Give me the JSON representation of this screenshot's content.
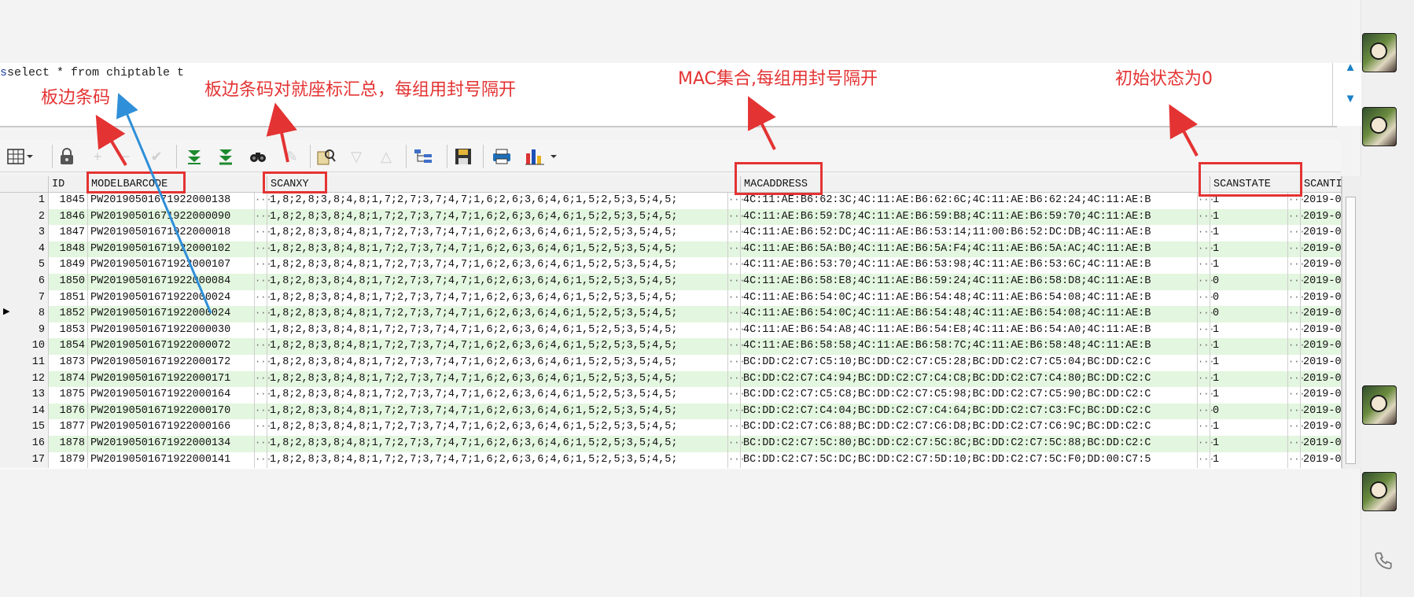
{
  "sql": {
    "text": "select * from chiptable t"
  },
  "annotations": {
    "note1": "板边条码",
    "note2": "板边条码对就座标汇总，每组用封号隔开",
    "note3": "MAC集合,每组用封号隔开",
    "note4": "初始状态为0"
  },
  "columns": [
    "ID",
    "MODELBARCODE",
    "SCANXY",
    "MACADDRESS",
    "SCANSTATE",
    "SCANTI"
  ],
  "rows": [
    {
      "n": "1",
      "id": "1845",
      "bc": "PW20190501671922000138",
      "xy": "1,8;2,8;3,8;4,8;1,7;2,7;3,7;4,7;1,6;2,6;3,6;4,6;1,5;2,5;3,5;4,5;",
      "mac": "4C:11:AE:B6:62:3C;4C:11:AE:B6:62:6C;4C:11:AE:B6:62:24;4C:11:AE:B",
      "st": "1",
      "dt": "2019-0"
    },
    {
      "n": "2",
      "id": "1846",
      "bc": "PW20190501671922000090",
      "xy": "1,8;2,8;3,8;4,8;1,7;2,7;3,7;4,7;1,6;2,6;3,6;4,6;1,5;2,5;3,5;4,5;",
      "mac": "4C:11:AE:B6:59:78;4C:11:AE:B6:59:B8;4C:11:AE:B6:59:70;4C:11:AE:B",
      "st": "1",
      "dt": "2019-0"
    },
    {
      "n": "3",
      "id": "1847",
      "bc": "PW20190501671922000018",
      "xy": "1,8;2,8;3,8;4,8;1,7;2,7;3,7;4,7;1,6;2,6;3,6;4,6;1,5;2,5;3,5;4,5;",
      "mac": "4C:11:AE:B6:52:DC;4C:11:AE:B6:53:14;11:00:B6:52:DC:DB;4C:11:AE:B",
      "st": "1",
      "dt": "2019-0"
    },
    {
      "n": "4",
      "id": "1848",
      "bc": "PW20190501671922000102",
      "xy": "1,8;2,8;3,8;4,8;1,7;2,7;3,7;4,7;1,6;2,6;3,6;4,6;1,5;2,5;3,5;4,5;",
      "mac": "4C:11:AE:B6:5A:B0;4C:11:AE:B6:5A:F4;4C:11:AE:B6:5A:AC;4C:11:AE:B",
      "st": "1",
      "dt": "2019-0"
    },
    {
      "n": "5",
      "id": "1849",
      "bc": "PW20190501671922000107",
      "xy": "1,8;2,8;3,8;4,8;1,7;2,7;3,7;4,7;1,6;2,6;3,6;4,6;1,5;2,5;3,5;4,5;",
      "mac": "4C:11:AE:B6:53:70;4C:11:AE:B6:53:98;4C:11:AE:B6:53:6C;4C:11:AE:B",
      "st": "1",
      "dt": "2019-0"
    },
    {
      "n": "6",
      "id": "1850",
      "bc": "PW20190501671922000084",
      "xy": "1,8;2,8;3,8;4,8;1,7;2,7;3,7;4,7;1,6;2,6;3,6;4,6;1,5;2,5;3,5;4,5;",
      "mac": "4C:11:AE:B6:58:E8;4C:11:AE:B6:59:24;4C:11:AE:B6:58:D8;4C:11:AE:B",
      "st": "0",
      "dt": "2019-0"
    },
    {
      "n": "7",
      "id": "1851",
      "bc": "PW20190501671922000024",
      "xy": "1,8;2,8;3,8;4,8;1,7;2,7;3,7;4,7;1,6;2,6;3,6;4,6;1,5;2,5;3,5;4,5;",
      "mac": "4C:11:AE:B6:54:0C;4C:11:AE:B6:54:48;4C:11:AE:B6:54:08;4C:11:AE:B",
      "st": "0",
      "dt": "2019-0"
    },
    {
      "n": "8",
      "id": "1852",
      "bc": "PW20190501671922000024",
      "xy": "1,8;2,8;3,8;4,8;1,7;2,7;3,7;4,7;1,6;2,6;3,6;4,6;1,5;2,5;3,5;4,5;",
      "mac": "4C:11:AE:B6:54:0C;4C:11:AE:B6:54:48;4C:11:AE:B6:54:08;4C:11:AE:B",
      "st": "0",
      "dt": "2019-0"
    },
    {
      "n": "9",
      "id": "1853",
      "bc": "PW20190501671922000030",
      "xy": "1,8;2,8;3,8;4,8;1,7;2,7;3,7;4,7;1,6;2,6;3,6;4,6;1,5;2,5;3,5;4,5;",
      "mac": "4C:11:AE:B6:54:A8;4C:11:AE:B6:54:E8;4C:11:AE:B6:54:A0;4C:11:AE:B",
      "st": "1",
      "dt": "2019-0"
    },
    {
      "n": "10",
      "id": "1854",
      "bc": "PW20190501671922000072",
      "xy": "1,8;2,8;3,8;4,8;1,7;2,7;3,7;4,7;1,6;2,6;3,6;4,6;1,5;2,5;3,5;4,5;",
      "mac": "4C:11:AE:B6:58:58;4C:11:AE:B6:58:7C;4C:11:AE:B6:58:48;4C:11:AE:B",
      "st": "1",
      "dt": "2019-0"
    },
    {
      "n": "11",
      "id": "1873",
      "bc": "PW20190501671922000172",
      "xy": "1,8;2,8;3,8;4,8;1,7;2,7;3,7;4,7;1,6;2,6;3,6;4,6;1,5;2,5;3,5;4,5;",
      "mac": "BC:DD:C2:C7:C5:10;BC:DD:C2:C7:C5:28;BC:DD:C2:C7:C5:04;BC:DD:C2:C",
      "st": "1",
      "dt": "2019-0"
    },
    {
      "n": "12",
      "id": "1874",
      "bc": "PW20190501671922000171",
      "xy": "1,8;2,8;3,8;4,8;1,7;2,7;3,7;4,7;1,6;2,6;3,6;4,6;1,5;2,5;3,5;4,5;",
      "mac": "BC:DD:C2:C7:C4:94;BC:DD:C2:C7:C4:C8;BC:DD:C2:C7:C4:80;BC:DD:C2:C",
      "st": "1",
      "dt": "2019-0"
    },
    {
      "n": "13",
      "id": "1875",
      "bc": "PW20190501671922000164",
      "xy": "1,8;2,8;3,8;4,8;1,7;2,7;3,7;4,7;1,6;2,6;3,6;4,6;1,5;2,5;3,5;4,5;",
      "mac": "BC:DD:C2:C7:C5:C8;BC:DD:C2:C7:C5:98;BC:DD:C2:C7:C5:90;BC:DD:C2:C",
      "st": "1",
      "dt": "2019-0"
    },
    {
      "n": "14",
      "id": "1876",
      "bc": "PW20190501671922000170",
      "xy": "1,8;2,8;3,8;4,8;1,7;2,7;3,7;4,7;1,6;2,6;3,6;4,6;1,5;2,5;3,5;4,5;",
      "mac": "BC:DD:C2:C7:C4:04;BC:DD:C2:C7:C4:64;BC:DD:C2:C7:C3:FC;BC:DD:C2:C",
      "st": "0",
      "dt": "2019-0"
    },
    {
      "n": "15",
      "id": "1877",
      "bc": "PW20190501671922000166",
      "xy": "1,8;2,8;3,8;4,8;1,7;2,7;3,7;4,7;1,6;2,6;3,6;4,6;1,5;2,5;3,5;4,5;",
      "mac": "BC:DD:C2:C7:C6:88;BC:DD:C2:C7:C6:D8;BC:DD:C2:C7:C6:9C;BC:DD:C2:C",
      "st": "1",
      "dt": "2019-0"
    },
    {
      "n": "16",
      "id": "1878",
      "bc": "PW20190501671922000134",
      "xy": "1,8;2,8;3,8;4,8;1,7;2,7;3,7;4,7;1,6;2,6;3,6;4,6;1,5;2,5;3,5;4,5;",
      "mac": "BC:DD:C2:C7:5C:80;BC:DD:C2:C7:5C:8C;BC:DD:C2:C7:5C:88;BC:DD:C2:C",
      "st": "1",
      "dt": "2019-0"
    },
    {
      "n": "17",
      "id": "1879",
      "bc": "PW20190501671922000141",
      "xy": "1,8;2,8;3,8;4,8;1,7;2,7;3,7;4,7;1,6;2,6;3,6;4,6;1,5;2,5;3,5;4,5;",
      "mac": "BC:DD:C2:C7:5C:DC;BC:DD:C2:C7:5D:10;BC:DD:C2:C7:5C:F0;DD:00:C7:5",
      "st": "1",
      "dt": "2019-0"
    }
  ],
  "toolbar_icons": [
    "grid-icon",
    "lock-icon",
    "add-icon",
    "delete-icon",
    "post-icon",
    "next-page-icon",
    "last-page-icon",
    "find-icon",
    "clear-icon",
    "query-icon",
    "filter-down-icon",
    "filter-up-icon",
    "tree-icon",
    "save-icon",
    "print-icon",
    "chart-icon"
  ],
  "colors": {
    "annotation": "#e43333",
    "row_alt": "#e3f6df",
    "link_arrow": "#2f8fd8"
  },
  "selected_row": "8"
}
